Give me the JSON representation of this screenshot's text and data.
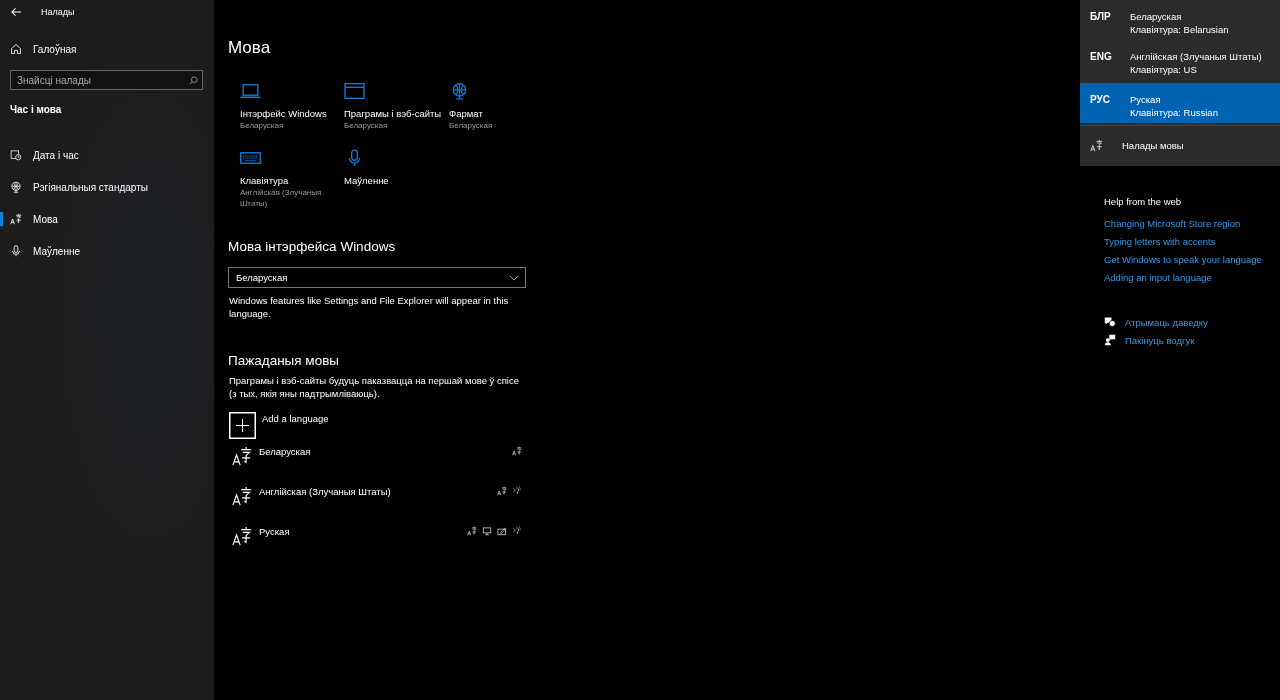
{
  "sidebar": {
    "title": "Налады",
    "home": "Галоўная",
    "search": {
      "placeholder": "Знайсці налады"
    },
    "section": "Час і мова",
    "items": [
      {
        "label": "Дата і час",
        "kind": "clock",
        "selected": false
      },
      {
        "label": "Рэгіянальныя стандарты",
        "kind": "globe",
        "selected": false
      },
      {
        "label": "Мова",
        "kind": "language",
        "selected": true
      },
      {
        "label": "Маўленне",
        "kind": "microphone",
        "selected": false
      }
    ]
  },
  "page": {
    "title": "Мова",
    "tiles": [
      {
        "label": "Інтэрфейс Windows",
        "value": "Беларуская",
        "kind": "laptop"
      },
      {
        "label": "Праграмы і вэб-сайты",
        "value": "Беларуская",
        "kind": "window"
      },
      {
        "label": "Фармат",
        "value": "Беларуская",
        "kind": "globe"
      },
      {
        "label": "Клавіятура",
        "value": "Англійская (Злучаныя Штаты)",
        "kind": "keyboard"
      },
      {
        "label": "Маўленне",
        "kind": "microphone"
      }
    ],
    "display_language": {
      "heading": "Мова інтэрфейса Windows",
      "value": "Беларуская",
      "note": "Windows features like Settings and File Explorer will appear in this language."
    },
    "preferred": {
      "heading": "Пажаданыя мовы",
      "note": "Праграмы і вэб-сайты будуць паказвацца на першай мове ў спісе (з тых, якія яны падтрымліваюць).",
      "add": "Add a language",
      "languages": [
        {
          "name": "Беларуская",
          "features": [
            {
              "kind": "language"
            }
          ]
        },
        {
          "name": "Англійская (Злучаныя Штаты)",
          "features": [
            {
              "kind": "language"
            },
            {
              "kind": "speech"
            }
          ]
        },
        {
          "name": "Руская",
          "features": [
            {
              "kind": "language"
            },
            {
              "kind": "display"
            },
            {
              "kind": "handwriting"
            },
            {
              "kind": "speech"
            }
          ]
        }
      ]
    }
  },
  "flyout": {
    "items": [
      {
        "code": "БЛР",
        "name": "Беларуская",
        "keyboard": "Клавіятура: Belarusian",
        "selected": false
      },
      {
        "code": "ENG",
        "name": "Англійская (Злучаныя Штаты)",
        "keyboard": "Клавіятура: US",
        "selected": false
      },
      {
        "code": "РУС",
        "name": "Руская",
        "keyboard": "Клавіятура: Russian",
        "selected": true
      }
    ],
    "settings": "Налады мовы"
  },
  "help": {
    "title": "Help from the web",
    "links": [
      "Changing Microsoft Store region",
      "Typing letters with accents",
      "Get Windows to speak your language",
      "Adding an input language"
    ],
    "actions": [
      {
        "label": "Атрымаць даведку",
        "kind": "help"
      },
      {
        "label": "Пакінуць водгук",
        "kind": "feedback"
      }
    ]
  }
}
